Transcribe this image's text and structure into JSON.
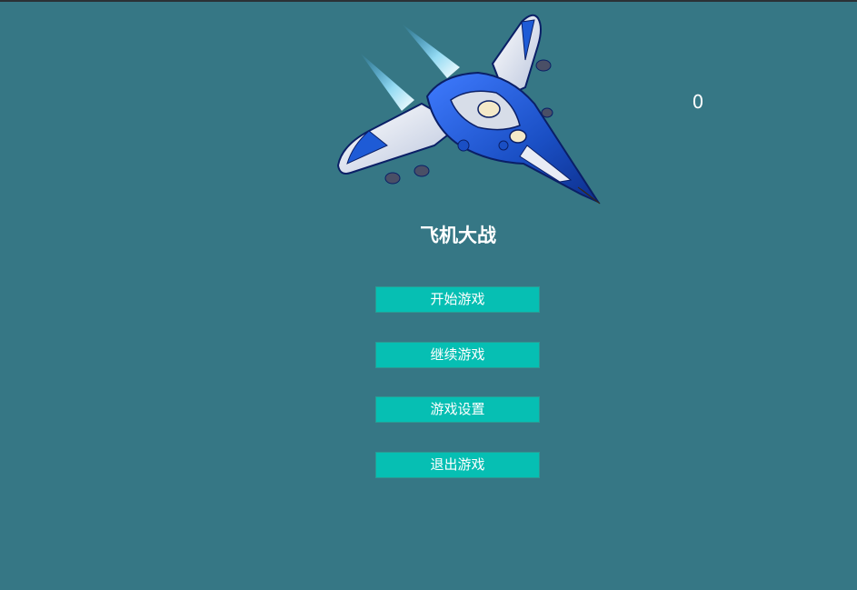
{
  "game": {
    "title": "飞机大战",
    "score": "0",
    "menu": {
      "start": "开始游戏",
      "continue": "继续游戏",
      "settings": "游戏设置",
      "exit": "退出游戏"
    }
  },
  "colors": {
    "background": "#367785",
    "button": "#06bfb3",
    "text": "#ffffff",
    "jet_primary": "#1e5bd6",
    "jet_secondary": "#e8ecf5"
  }
}
